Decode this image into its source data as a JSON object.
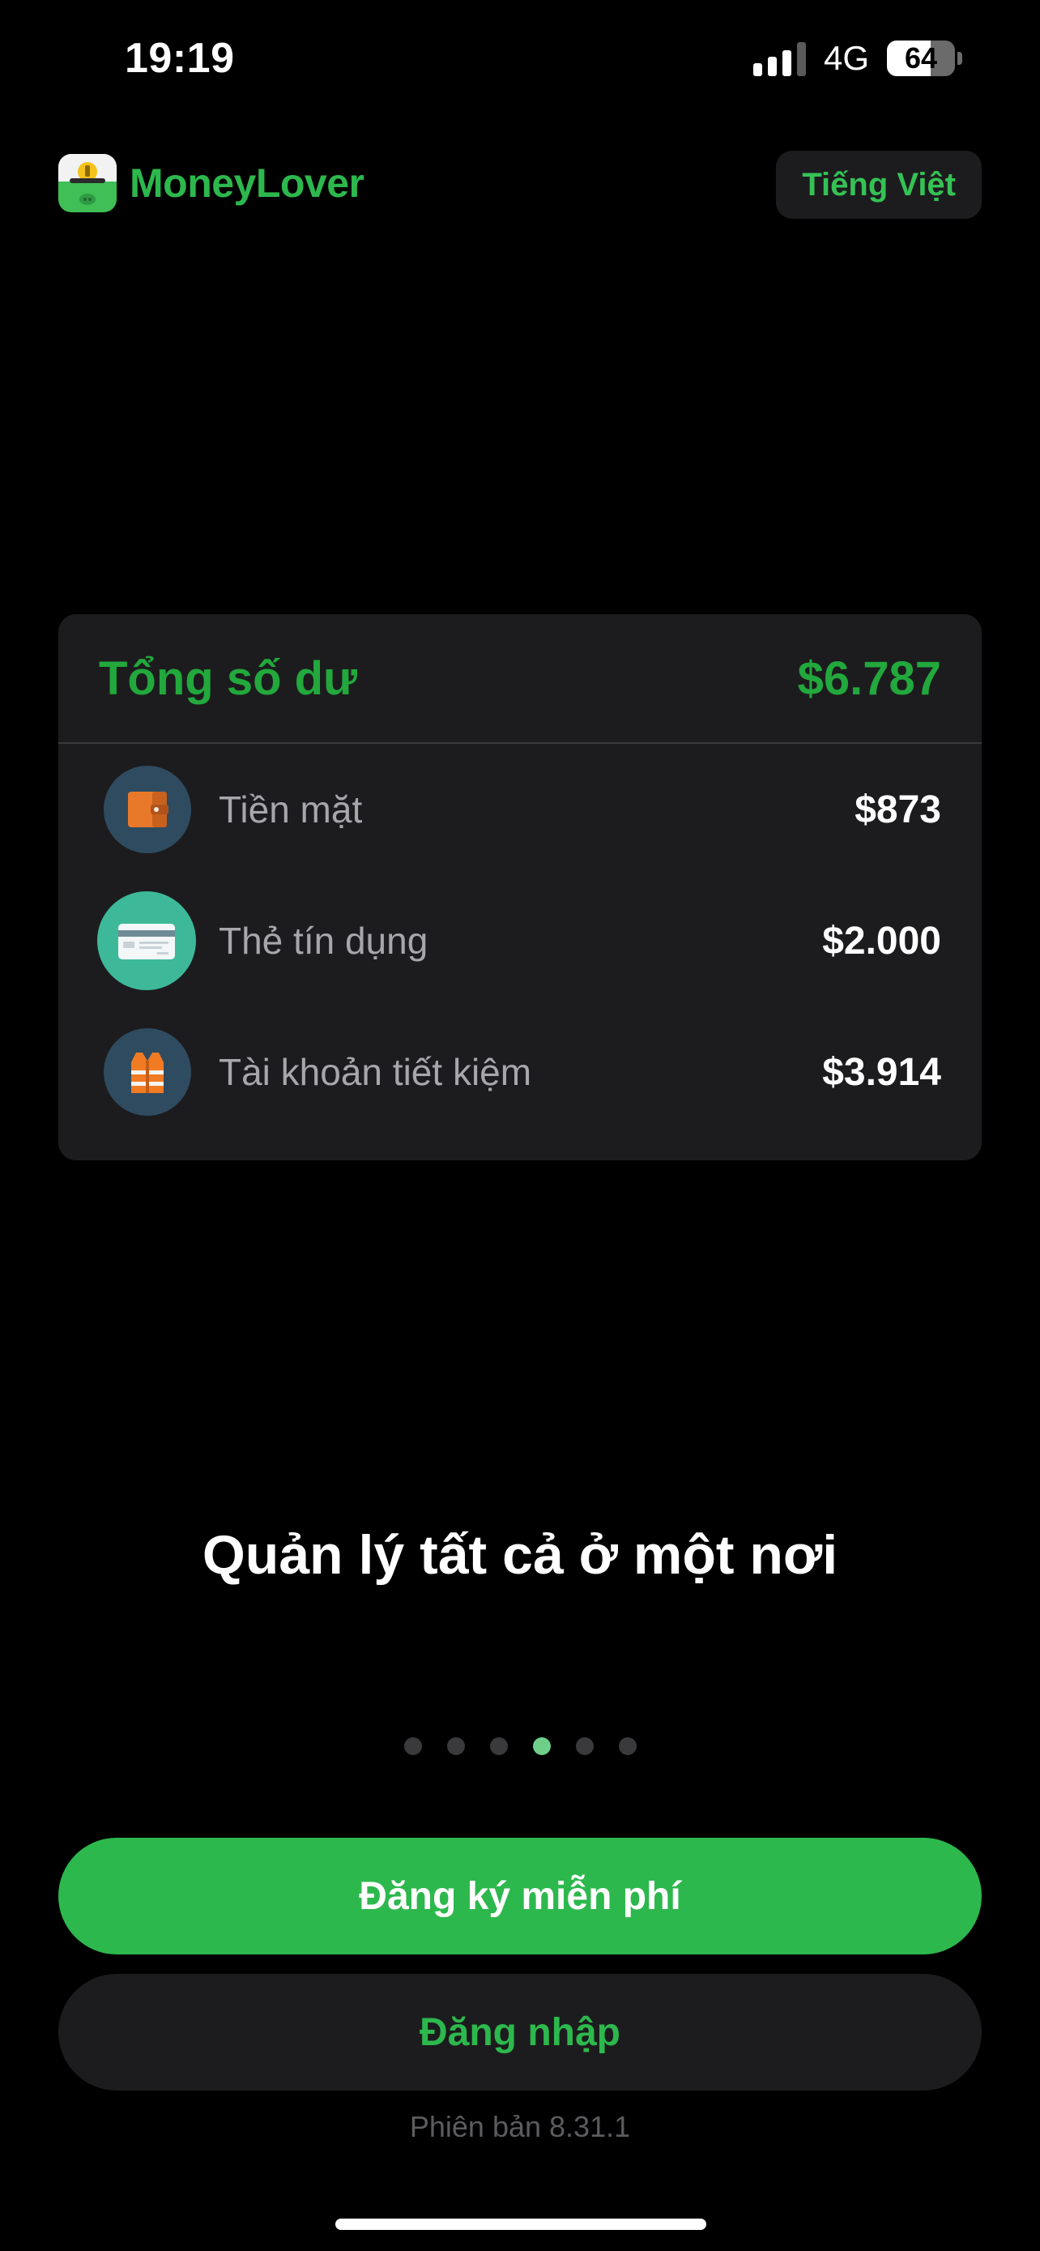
{
  "status_bar": {
    "time": "19:19",
    "network": "4G",
    "battery_level": "64",
    "battery_fraction": 0.64,
    "icons": [
      "signal-icon",
      "battery-icon"
    ]
  },
  "header": {
    "app_name": "MoneyLover",
    "language_button": "Tiếng Việt",
    "brand_color": "#2db84d"
  },
  "balance_card": {
    "title": "Tổng số dư",
    "total": "$6.787",
    "accounts": [
      {
        "icon": "wallet-icon",
        "label": "Tiền mặt",
        "value": "$873"
      },
      {
        "icon": "credit-card-icon",
        "label": "Thẻ tín dụng",
        "value": "$2.000"
      },
      {
        "icon": "life-vest-icon",
        "label": "Tài khoản tiết kiệm",
        "value": "$3.914"
      }
    ]
  },
  "onboarding": {
    "title": "Quản lý tất cả ở một nơi",
    "page_count": 6,
    "active_page": 4
  },
  "actions": {
    "register": "Đăng ký miễn phí",
    "login": "Đăng nhập"
  },
  "footer": {
    "version": "Phiên bản 8.31.1"
  }
}
